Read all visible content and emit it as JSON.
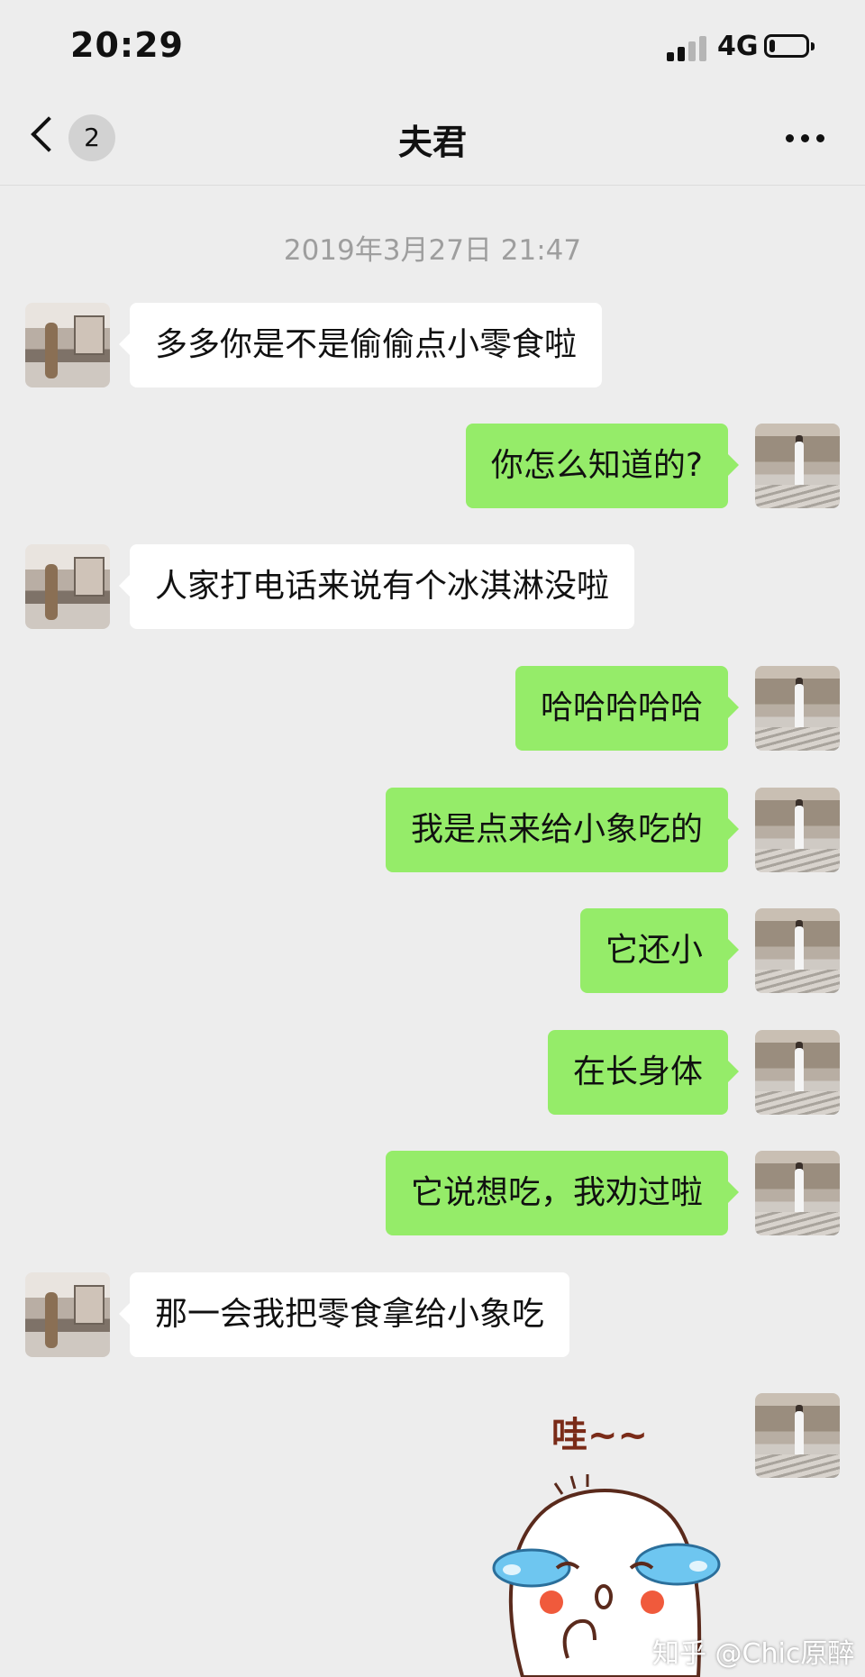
{
  "status_bar": {
    "time": "20:29",
    "network": "4G",
    "battery_level": 0.15
  },
  "nav": {
    "unread_count": "2",
    "title": "夫君",
    "back_icon": "chevron-left-icon",
    "more_icon": "more-dots-icon"
  },
  "timestamp": "2019年3月27日 21:47",
  "messages": [
    {
      "side": "left",
      "text": "多多你是不是偷偷点小零食啦"
    },
    {
      "side": "right",
      "text": "你怎么知道的?"
    },
    {
      "side": "left",
      "text": "人家打电话来说有个冰淇淋没啦"
    },
    {
      "side": "right",
      "text": "哈哈哈哈哈"
    },
    {
      "side": "right",
      "text": "我是点来给小象吃的"
    },
    {
      "side": "right",
      "text": "它还小"
    },
    {
      "side": "right",
      "text": "在长身体"
    },
    {
      "side": "right",
      "text": "它说想吃，我劝过啦"
    },
    {
      "side": "left",
      "text": "那一会我把零食拿给小象吃"
    }
  ],
  "sticker": {
    "text": "哇~~",
    "icon": "crying-face-sticker"
  },
  "watermark": "知乎 @Chic原醉",
  "colors": {
    "background": "#ededed",
    "outgoing_bubble": "#95ec69",
    "incoming_bubble": "#ffffff",
    "timestamp": "#9e9e9e"
  }
}
